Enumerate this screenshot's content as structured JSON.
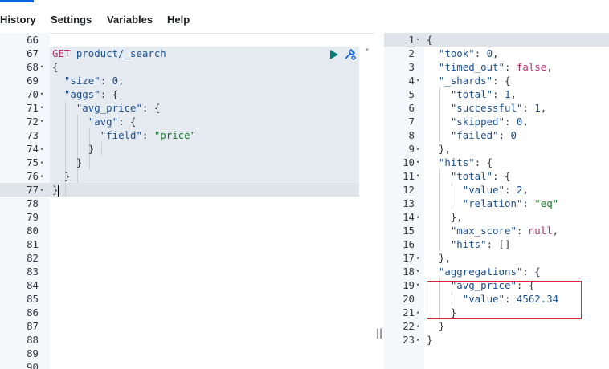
{
  "menu": [
    "History",
    "Settings",
    "Variables",
    "Help"
  ],
  "request": {
    "lines": [
      {
        "n": "66",
        "f": "",
        "parts": []
      },
      {
        "n": "67",
        "f": "",
        "parts": [
          {
            "t": "GET ",
            "c": "m"
          },
          {
            "t": "product/_search",
            "c": "k"
          }
        ]
      },
      {
        "n": "68",
        "f": "▾",
        "parts": [
          {
            "t": "{",
            "c": "p"
          }
        ]
      },
      {
        "n": "69",
        "f": "",
        "parts": [
          {
            "t": "  ",
            "c": "p"
          },
          {
            "t": "\"size\"",
            "c": "k"
          },
          {
            "t": ": ",
            "c": "p"
          },
          {
            "t": "0",
            "c": "n"
          },
          {
            "t": ",",
            "c": "p"
          }
        ]
      },
      {
        "n": "70",
        "f": "▾",
        "parts": [
          {
            "t": "  ",
            "c": "p"
          },
          {
            "t": "\"aggs\"",
            "c": "k"
          },
          {
            "t": ": {",
            "c": "p"
          }
        ]
      },
      {
        "n": "71",
        "f": "▾",
        "parts": [
          {
            "t": "    ",
            "c": "p"
          },
          {
            "t": "\"avg_price\"",
            "c": "k"
          },
          {
            "t": ": {",
            "c": "p"
          }
        ]
      },
      {
        "n": "72",
        "f": "▾",
        "parts": [
          {
            "t": "      ",
            "c": "p"
          },
          {
            "t": "\"avg\"",
            "c": "k"
          },
          {
            "t": ": {",
            "c": "p"
          }
        ]
      },
      {
        "n": "73",
        "f": "",
        "parts": [
          {
            "t": "        ",
            "c": "p"
          },
          {
            "t": "\"field\"",
            "c": "k"
          },
          {
            "t": ": ",
            "c": "p"
          },
          {
            "t": "\"price\"",
            "c": "s"
          }
        ]
      },
      {
        "n": "74",
        "f": "▴",
        "parts": [
          {
            "t": "      }",
            "c": "p"
          }
        ]
      },
      {
        "n": "75",
        "f": "▴",
        "parts": [
          {
            "t": "    }",
            "c": "p"
          }
        ]
      },
      {
        "n": "76",
        "f": "▴",
        "parts": [
          {
            "t": "  }",
            "c": "p"
          }
        ]
      },
      {
        "n": "77",
        "f": "▴",
        "parts": [
          {
            "t": "}",
            "c": "p"
          }
        ],
        "cursor": true
      },
      {
        "n": "78",
        "f": "",
        "parts": []
      },
      {
        "n": "79",
        "f": "",
        "parts": []
      },
      {
        "n": "80",
        "f": "",
        "parts": []
      },
      {
        "n": "81",
        "f": "",
        "parts": []
      },
      {
        "n": "82",
        "f": "",
        "parts": []
      },
      {
        "n": "83",
        "f": "",
        "parts": []
      },
      {
        "n": "84",
        "f": "",
        "parts": []
      },
      {
        "n": "85",
        "f": "",
        "parts": []
      },
      {
        "n": "86",
        "f": "",
        "parts": []
      },
      {
        "n": "87",
        "f": "",
        "parts": []
      },
      {
        "n": "88",
        "f": "",
        "parts": []
      },
      {
        "n": "89",
        "f": "",
        "parts": []
      },
      {
        "n": "90",
        "f": "",
        "parts": []
      }
    ]
  },
  "response": {
    "lines": [
      {
        "n": "1",
        "f": "▾",
        "parts": [
          {
            "t": "{",
            "c": "p"
          }
        ]
      },
      {
        "n": "2",
        "f": "",
        "parts": [
          {
            "t": "  ",
            "c": "p"
          },
          {
            "t": "\"took\"",
            "c": "k"
          },
          {
            "t": ": ",
            "c": "p"
          },
          {
            "t": "0",
            "c": "n"
          },
          {
            "t": ",",
            "c": "p"
          }
        ]
      },
      {
        "n": "3",
        "f": "",
        "parts": [
          {
            "t": "  ",
            "c": "p"
          },
          {
            "t": "\"timed_out\"",
            "c": "k"
          },
          {
            "t": ": ",
            "c": "p"
          },
          {
            "t": "false",
            "c": "b"
          },
          {
            "t": ",",
            "c": "p"
          }
        ]
      },
      {
        "n": "4",
        "f": "▾",
        "parts": [
          {
            "t": "  ",
            "c": "p"
          },
          {
            "t": "\"_shards\"",
            "c": "k"
          },
          {
            "t": ": {",
            "c": "p"
          }
        ]
      },
      {
        "n": "5",
        "f": "",
        "parts": [
          {
            "t": "    ",
            "c": "p"
          },
          {
            "t": "\"total\"",
            "c": "k"
          },
          {
            "t": ": ",
            "c": "p"
          },
          {
            "t": "1",
            "c": "n"
          },
          {
            "t": ",",
            "c": "p"
          }
        ]
      },
      {
        "n": "6",
        "f": "",
        "parts": [
          {
            "t": "    ",
            "c": "p"
          },
          {
            "t": "\"successful\"",
            "c": "k"
          },
          {
            "t": ": ",
            "c": "p"
          },
          {
            "t": "1",
            "c": "n"
          },
          {
            "t": ",",
            "c": "p"
          }
        ]
      },
      {
        "n": "7",
        "f": "",
        "parts": [
          {
            "t": "    ",
            "c": "p"
          },
          {
            "t": "\"skipped\"",
            "c": "k"
          },
          {
            "t": ": ",
            "c": "p"
          },
          {
            "t": "0",
            "c": "n"
          },
          {
            "t": ",",
            "c": "p"
          }
        ]
      },
      {
        "n": "8",
        "f": "",
        "parts": [
          {
            "t": "    ",
            "c": "p"
          },
          {
            "t": "\"failed\"",
            "c": "k"
          },
          {
            "t": ": ",
            "c": "p"
          },
          {
            "t": "0",
            "c": "n"
          }
        ]
      },
      {
        "n": "9",
        "f": "▴",
        "parts": [
          {
            "t": "  },",
            "c": "p"
          }
        ]
      },
      {
        "n": "10",
        "f": "▾",
        "parts": [
          {
            "t": "  ",
            "c": "p"
          },
          {
            "t": "\"hits\"",
            "c": "k"
          },
          {
            "t": ": {",
            "c": "p"
          }
        ]
      },
      {
        "n": "11",
        "f": "▾",
        "parts": [
          {
            "t": "    ",
            "c": "p"
          },
          {
            "t": "\"total\"",
            "c": "k"
          },
          {
            "t": ": {",
            "c": "p"
          }
        ]
      },
      {
        "n": "12",
        "f": "",
        "parts": [
          {
            "t": "      ",
            "c": "p"
          },
          {
            "t": "\"value\"",
            "c": "k"
          },
          {
            "t": ": ",
            "c": "p"
          },
          {
            "t": "2",
            "c": "n"
          },
          {
            "t": ",",
            "c": "p"
          }
        ]
      },
      {
        "n": "13",
        "f": "",
        "parts": [
          {
            "t": "      ",
            "c": "p"
          },
          {
            "t": "\"relation\"",
            "c": "k"
          },
          {
            "t": ": ",
            "c": "p"
          },
          {
            "t": "\"eq\"",
            "c": "s"
          }
        ]
      },
      {
        "n": "14",
        "f": "▴",
        "parts": [
          {
            "t": "    },",
            "c": "p"
          }
        ]
      },
      {
        "n": "15",
        "f": "",
        "parts": [
          {
            "t": "    ",
            "c": "p"
          },
          {
            "t": "\"max_score\"",
            "c": "k"
          },
          {
            "t": ": ",
            "c": "p"
          },
          {
            "t": "null",
            "c": "b"
          },
          {
            "t": ",",
            "c": "p"
          }
        ]
      },
      {
        "n": "16",
        "f": "",
        "parts": [
          {
            "t": "    ",
            "c": "p"
          },
          {
            "t": "\"hits\"",
            "c": "k"
          },
          {
            "t": ": []",
            "c": "p"
          }
        ]
      },
      {
        "n": "17",
        "f": "▴",
        "parts": [
          {
            "t": "  },",
            "c": "p"
          }
        ]
      },
      {
        "n": "18",
        "f": "▾",
        "parts": [
          {
            "t": "  ",
            "c": "p"
          },
          {
            "t": "\"aggregations\"",
            "c": "k"
          },
          {
            "t": ": {",
            "c": "p"
          }
        ]
      },
      {
        "n": "19",
        "f": "▾",
        "parts": [
          {
            "t": "    ",
            "c": "p"
          },
          {
            "t": "\"avg_price\"",
            "c": "k"
          },
          {
            "t": ": {",
            "c": "p"
          }
        ]
      },
      {
        "n": "20",
        "f": "",
        "parts": [
          {
            "t": "      ",
            "c": "p"
          },
          {
            "t": "\"value\"",
            "c": "k"
          },
          {
            "t": ": ",
            "c": "p"
          },
          {
            "t": "4562.34",
            "c": "n"
          }
        ]
      },
      {
        "n": "21",
        "f": "▴",
        "parts": [
          {
            "t": "    }",
            "c": "p"
          }
        ]
      },
      {
        "n": "22",
        "f": "▴",
        "parts": [
          {
            "t": "  }",
            "c": "p"
          }
        ]
      },
      {
        "n": "23",
        "f": "▴",
        "parts": [
          {
            "t": "}",
            "c": "p"
          }
        ]
      }
    ]
  },
  "icons": {
    "run": "play-icon",
    "settings": "wrench-icon"
  },
  "colors": {
    "accent": "#0b64dd",
    "highlight_border": "#d62c2c",
    "request_bg": "#e6ebf2"
  }
}
